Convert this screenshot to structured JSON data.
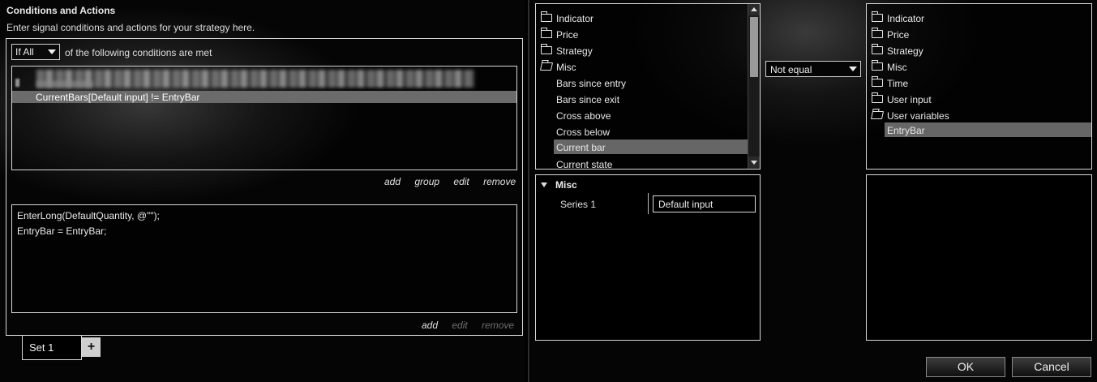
{
  "conditions_actions": {
    "title": "Conditions and Actions",
    "subtitle": "Enter signal conditions and actions for your strategy here.",
    "match_select": "If All",
    "match_suffix": "of the following conditions are met",
    "conditions": [
      {
        "text": "CurrentBars[Default input] != EntryBar",
        "selected": true
      }
    ],
    "condition_links": {
      "add": "add",
      "group": "group",
      "edit": "edit",
      "remove": "remove"
    },
    "actions": [
      "EnterLong(DefaultQuantity, @\"\");",
      "EntryBar = EntryBar;"
    ],
    "action_links": {
      "add": "add",
      "edit": "edit",
      "remove": "remove"
    },
    "set_tab": "Set 1",
    "add_tab": "+"
  },
  "left_tree": {
    "folders": [
      "Indicator",
      "Price",
      "Strategy",
      "Misc"
    ],
    "misc_items": [
      "Bars since entry",
      "Bars since exit",
      "Cross above",
      "Cross below",
      "Current bar",
      "Current state"
    ],
    "selected": "Current bar"
  },
  "comparison": {
    "operator": "Not equal"
  },
  "right_tree": {
    "folders": [
      "Indicator",
      "Price",
      "Strategy",
      "Misc",
      "Time",
      "User input",
      "User variables"
    ],
    "user_variable_items": [
      "EntryBar"
    ],
    "selected": "EntryBar"
  },
  "properties": {
    "group": "Misc",
    "key": "Series 1",
    "value": "Default input"
  },
  "buttons": {
    "ok": "OK",
    "cancel": "Cancel"
  }
}
